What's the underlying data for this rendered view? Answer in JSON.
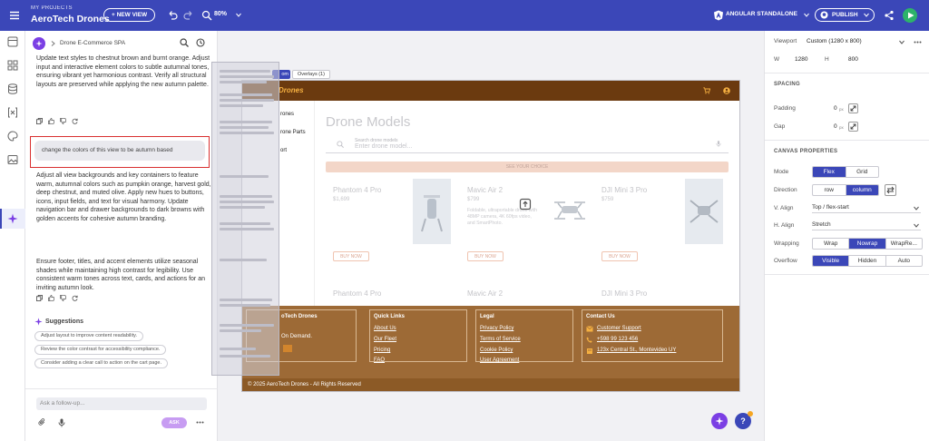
{
  "topbar": {
    "my_projects": "MY PROJECTS",
    "project_name": "AeroTech Drones",
    "new_view": "+ NEW VIEW",
    "zoom": "80%",
    "framework": "ANGULAR STANDALONE",
    "publish": "PUBLISH"
  },
  "chat": {
    "breadcrumb": "Drone E-Commerce SPA",
    "msg1": "Update text styles to chestnut brown and burnt orange. Adjust input and interactive element colors to subtle autumnal tones, ensuring vibrant yet harmonious contrast. Verify all structural layouts are preserved while applying the new autumn palette.",
    "prompt": "change the colors of this view to be autumn based",
    "msg2a": "Adjust all view backgrounds and key containers to feature warm, autumnal colors such as pumpkin orange, harvest gold, deep chestnut, and muted olive. Apply new hues to buttons, icons, input fields, and text for visual harmony. Update navigation bar and drawer backgrounds to dark browns with golden accents for cohesive autumn branding.",
    "msg2b": "Ensure footer, titles, and accent elements utilize seasonal shades while maintaining high contrast for legibility. Use consistent warm tones across text, cards, and actions for an inviting autumn look.",
    "suggestions_title": "Suggestions",
    "suggestions": [
      "Adjust layout to improve content readability.",
      "Review the color contrast for accessibility compliance.",
      "Consider adding a clear call to action on the cart page."
    ],
    "input_placeholder": "Ask a follow-up...",
    "ask": "ASK"
  },
  "canvas": {
    "chip_label": "om",
    "overlays": "Overlays (1)",
    "app_title": "Drones",
    "side_items": [
      "rones",
      "rone Parts",
      "ort"
    ],
    "main_title": "Drone Models",
    "search_label": "Search drone models",
    "search_placeholder": "Enter drone model...",
    "banner": "SEE YOUR CHOICE",
    "products": [
      {
        "name": "Phantom 4 Pro",
        "price": "$1,699",
        "buy": "BUY NOW"
      },
      {
        "name": "Mavic Air 2",
        "price": "$799",
        "desc": "Foldable, ultraportable drone with 48MP camera, 4K 60fps video, and SmartPhoto.",
        "buy": "BUY NOW"
      },
      {
        "name": "DJI Mini 3 Pro",
        "price": "$759",
        "buy": "BUY NOW"
      }
    ],
    "row2": [
      "Phantom 4 Pro",
      "Mavic Air 2",
      "DJI Mini 3 Pro"
    ],
    "footer": {
      "brand_title": "oTech Drones",
      "brand_tag": "On Demand.",
      "quick_links_title": "Quick Links",
      "quick_links": [
        "About Us",
        "Our Fleet",
        "Pricing",
        "FAQ"
      ],
      "legal_title": "Legal",
      "legal": [
        "Privacy Policy",
        "Terms of Service",
        "Cookie Policy",
        "User Agreement"
      ],
      "contact_title": "Contact Us",
      "contact": [
        "Customer Support",
        "+598 99 123 456",
        "123x Central St., Montevideo UY"
      ],
      "copyright": "© 2025 AeroTech Drones - All Rights Reserved"
    }
  },
  "props": {
    "viewport_label": "Viewport",
    "viewport_value": "Custom (1280 x 800)",
    "w_label": "W",
    "w_value": "1280",
    "h_label": "H",
    "h_value": "800",
    "spacing": "SPACING",
    "padding_label": "Padding",
    "padding_value": "0",
    "gap_label": "Gap",
    "gap_value": "0",
    "unit": "px",
    "canvas_props": "CANVAS PROPERTIES",
    "mode_label": "Mode",
    "mode": [
      "Flex",
      "Grid"
    ],
    "direction_label": "Direction",
    "direction": [
      "row",
      "column"
    ],
    "valign_label": "V. Align",
    "valign_value": "Top / flex-start",
    "halign_label": "H. Align",
    "halign_value": "Stretch",
    "wrapping_label": "Wrapping",
    "wrapping": [
      "Wrap",
      "Nowrap",
      "WrapRe..."
    ],
    "overflow_label": "Overflow",
    "overflow": [
      "Visible",
      "Hidden",
      "Auto"
    ]
  },
  "colors": {
    "brand": "#3b47b8",
    "nav_brown": "#6b3a0f",
    "footer_brown": "#9d6a36",
    "accent_gold": "#f5b041",
    "highlight_red": "#d93030"
  },
  "icons": [
    "menu-icon",
    "undo-icon",
    "redo-icon",
    "zoom-icon",
    "search-icon",
    "history-icon",
    "copy-icon",
    "thumbs-up-icon",
    "thumbs-down-icon",
    "refresh-icon",
    "sparkle-icon",
    "attach-icon",
    "mic-icon",
    "more-icon",
    "github-icon",
    "share-icon",
    "play-icon",
    "cart-icon",
    "user-icon",
    "upload-icon",
    "help-icon"
  ]
}
